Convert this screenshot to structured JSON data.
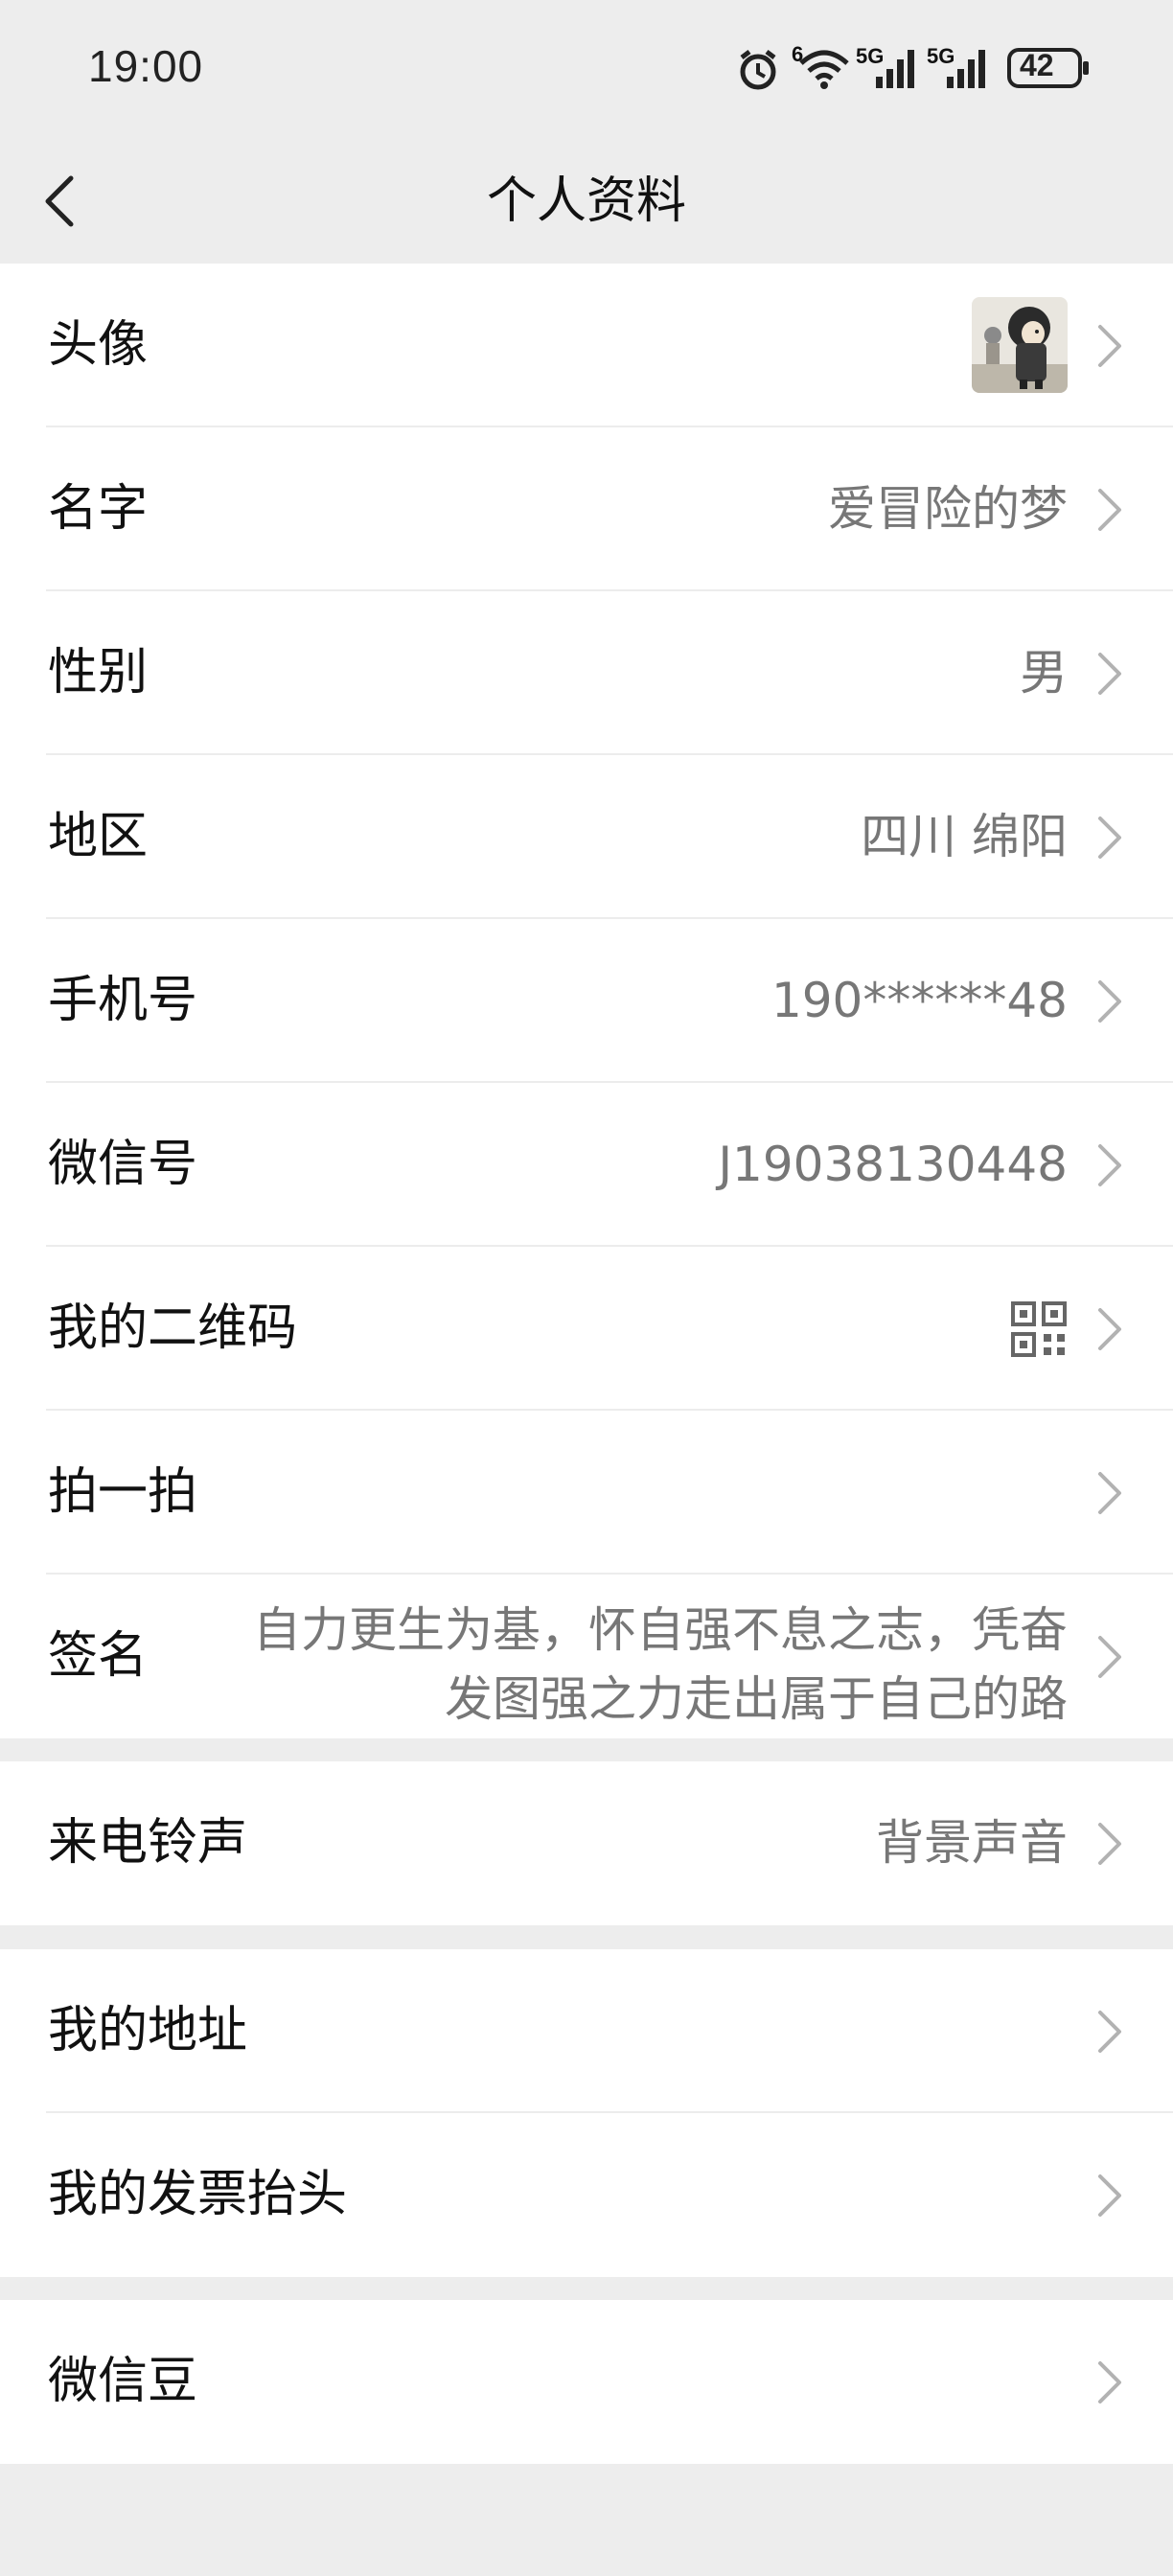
{
  "status_bar": {
    "time": "19:00",
    "battery": "42",
    "signal_labels": [
      "5G",
      "5G"
    ],
    "wifi_label": "6",
    "icons": [
      "alarm-icon",
      "wifi-icon",
      "signal-icon",
      "signal-icon",
      "battery-icon"
    ]
  },
  "navbar": {
    "title": "个人资料",
    "back_icon": "chevron-left-icon"
  },
  "profile": {
    "avatar_label": "头像",
    "name_label": "名字",
    "name_value": "爱冒险的梦",
    "gender_label": "性别",
    "gender_value": "男",
    "region_label": "地区",
    "region_value": "四川 绵阳",
    "phone_label": "手机号",
    "phone_value": "190******48",
    "wechat_id_label": "微信号",
    "wechat_id_value": "J19038130448",
    "qrcode_label": "我的二维码",
    "pat_label": "拍一拍",
    "signature_label": "签名",
    "signature_line1": "自力更生为基，怀自强不息之志，凭奋",
    "signature_line2": "发图强之力走出属于自己的路"
  },
  "ringtone": {
    "label": "来电铃声",
    "value": "背景声音"
  },
  "addresses": {
    "address_label": "我的地址",
    "invoice_label": "我的发票抬头"
  },
  "beans": {
    "label": "微信豆"
  },
  "colors": {
    "background": "#ededed",
    "card": "#ffffff",
    "value_text": "#777777",
    "chevron": "#b2b2b2"
  }
}
